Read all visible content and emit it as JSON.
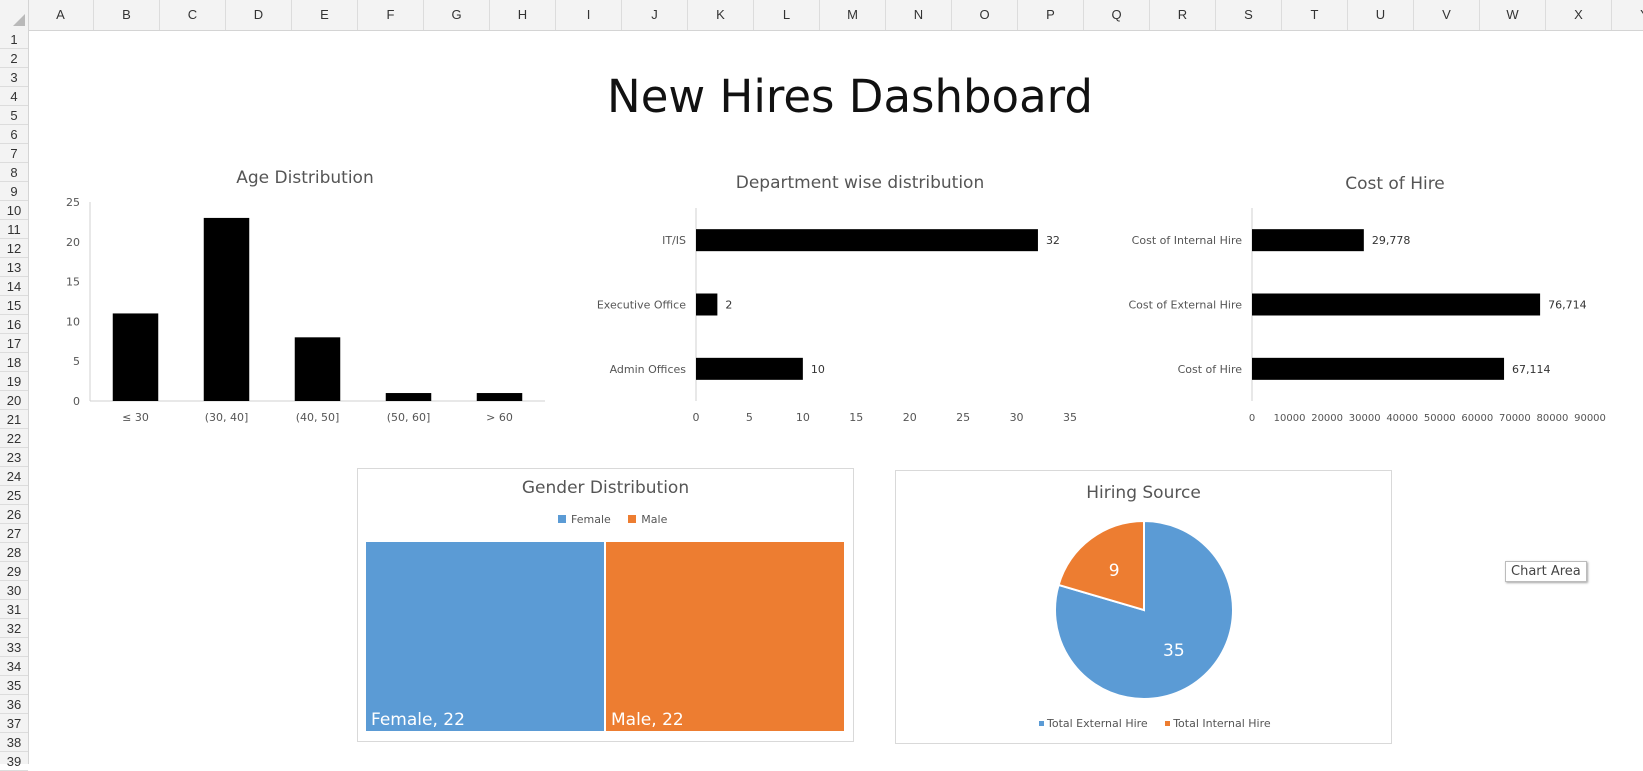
{
  "sheet": {
    "columns": [
      "A",
      "B",
      "C",
      "D",
      "E",
      "F",
      "G",
      "H",
      "I",
      "J",
      "K",
      "L",
      "M",
      "N",
      "O",
      "P",
      "Q",
      "R",
      "S",
      "T",
      "U",
      "V",
      "W",
      "X",
      "Y"
    ],
    "rows": [
      "1",
      "2",
      "3",
      "4",
      "5",
      "6",
      "7",
      "8",
      "9",
      "10",
      "11",
      "12",
      "13",
      "14",
      "15",
      "16",
      "17",
      "18",
      "19",
      "20",
      "21",
      "22",
      "23",
      "24",
      "25",
      "26",
      "27",
      "28",
      "29",
      "30",
      "31",
      "32",
      "33",
      "34",
      "35",
      "36",
      "37",
      "38",
      "39"
    ]
  },
  "dashboard": {
    "title": "New Hires Dashboard"
  },
  "tooltip": {
    "text": "Chart Area"
  },
  "colors": {
    "bar": "#000000",
    "blue": "#5b9bd5",
    "orange": "#ed7d31"
  },
  "chart_data": [
    {
      "id": "age",
      "type": "bar",
      "title": "Age Distribution",
      "categories": [
        "≤ 30",
        "(30, 40]",
        "(40, 50]",
        "(50, 60]",
        "> 60"
      ],
      "values": [
        11,
        23,
        8,
        1,
        1
      ],
      "ylim": [
        0,
        25
      ],
      "yticks": [
        "0",
        "5",
        "10",
        "15",
        "20",
        "25"
      ],
      "grid": false
    },
    {
      "id": "department",
      "type": "bar",
      "orientation": "horizontal",
      "title": "Department wise distribution",
      "categories": [
        "IT/IS",
        "Executive Office",
        "Admin Offices"
      ],
      "values": [
        32,
        2,
        10
      ],
      "data_labels": [
        "32",
        "2",
        "10"
      ],
      "xlim": [
        0,
        35
      ],
      "xticks": [
        "0",
        "5",
        "10",
        "15",
        "20",
        "25",
        "30",
        "35"
      ]
    },
    {
      "id": "cost",
      "type": "bar",
      "orientation": "horizontal",
      "title": "Cost of Hire",
      "categories": [
        "Cost of Internal Hire",
        "Cost of External Hire",
        "Cost of Hire"
      ],
      "values": [
        29778,
        76714,
        67114
      ],
      "data_labels": [
        "29,778",
        "76,714",
        "67,114"
      ],
      "xlim": [
        0,
        90000
      ],
      "xticks": [
        "0",
        "10000",
        "20000",
        "30000",
        "40000",
        "50000",
        "60000",
        "70000",
        "80000",
        "90000"
      ]
    },
    {
      "id": "gender",
      "type": "treemap",
      "title": "Gender Distribution",
      "legend": [
        "Female",
        "Male"
      ],
      "legend_position": "top",
      "series": [
        {
          "name": "Female",
          "value": 22,
          "label": "Female, 22",
          "color": "#5b9bd5"
        },
        {
          "name": "Male",
          "value": 22,
          "label": "Male, 22",
          "color": "#ed7d31"
        }
      ]
    },
    {
      "id": "source",
      "type": "pie",
      "title": "Hiring Source",
      "legend_position": "bottom",
      "slices": [
        {
          "name": "Total External Hire",
          "value": 35,
          "label": "35",
          "color": "#5b9bd5"
        },
        {
          "name": "Total Internal Hire",
          "value": 9,
          "label": "9",
          "color": "#ed7d31"
        }
      ]
    }
  ]
}
